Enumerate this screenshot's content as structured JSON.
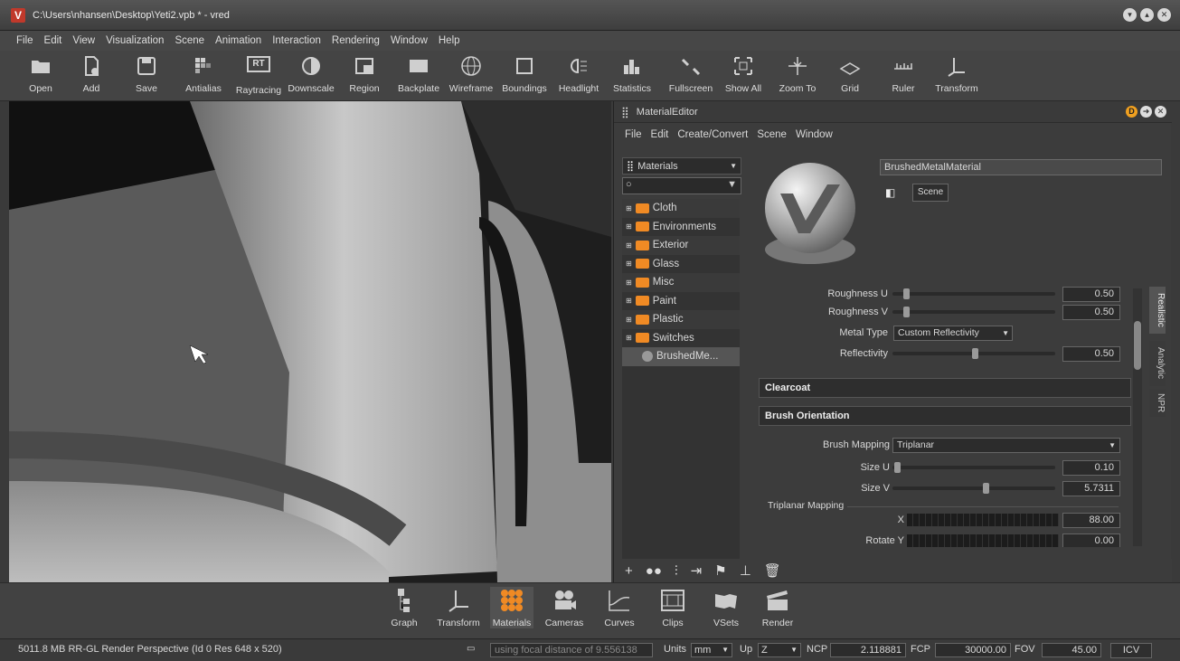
{
  "window": {
    "title": "C:\\Users\\nhansen\\Desktop\\Yeti2.vpb * - vred",
    "app_icon": "V"
  },
  "menubar": [
    "File",
    "Edit",
    "View",
    "Visualization",
    "Scene",
    "Animation",
    "Interaction",
    "Rendering",
    "Window",
    "Help"
  ],
  "toolbar": {
    "tools": [
      {
        "label": "Open",
        "icon": "folder-open-icon"
      },
      {
        "label": "Add",
        "icon": "add-file-icon"
      },
      {
        "label": "Save",
        "icon": "save-icon"
      },
      {
        "label": "Antialias",
        "icon": "antialias-icon"
      },
      {
        "label": "Raytracing",
        "icon": "raytracing-icon",
        "text": "RT"
      },
      {
        "label": "Downscale",
        "icon": "downscale-icon"
      },
      {
        "label": "Region",
        "icon": "region-icon"
      },
      {
        "label": "Backplate",
        "icon": "backplate-icon"
      },
      {
        "label": "Wireframe",
        "icon": "wireframe-icon"
      },
      {
        "label": "Boundings",
        "icon": "boundings-icon"
      },
      {
        "label": "Headlight",
        "icon": "headlight-icon"
      },
      {
        "label": "Statistics",
        "icon": "statistics-icon"
      },
      {
        "label": "Fullscreen",
        "icon": "fullscreen-icon"
      },
      {
        "label": "Show All",
        "icon": "show-all-icon"
      },
      {
        "label": "Zoom To",
        "icon": "zoom-to-icon"
      },
      {
        "label": "Grid",
        "icon": "grid-icon"
      },
      {
        "label": "Ruler",
        "icon": "ruler-icon"
      },
      {
        "label": "Transform",
        "icon": "transform-icon"
      }
    ]
  },
  "material_editor": {
    "title": "MaterialEditor",
    "menu": [
      "File",
      "Edit",
      "Create/Convert",
      "Scene",
      "Window"
    ],
    "materials_dropdown": "Materials",
    "tree": [
      "Cloth",
      "Environments",
      "Exterior",
      "Glass",
      "Misc",
      "Paint",
      "Plastic",
      "Switches",
      "BrushedMe..."
    ],
    "material_name": "BrushedMetalMaterial",
    "scene_button": "Scene",
    "props": {
      "roughness_u": {
        "label": "Roughness U",
        "value": "0.50"
      },
      "roughness_v": {
        "label": "Roughness V",
        "value": "0.50"
      },
      "metal_type": {
        "label": "Metal Type",
        "value": "Custom Reflectivity"
      },
      "reflectivity": {
        "label": "Reflectivity",
        "value": "0.50"
      },
      "clearcoat": "Clearcoat",
      "brush_orientation": "Brush Orientation",
      "brush_mapping": {
        "label": "Brush Mapping",
        "value": "Triplanar"
      },
      "size_u": {
        "label": "Size U",
        "value": "0.10"
      },
      "size_v": {
        "label": "Size V",
        "value": "5.7311"
      },
      "triplanar_mapping": "Triplanar Mapping",
      "x": {
        "label": "X",
        "value": "88.00"
      },
      "rotate_y": {
        "label": "Rotate  Y",
        "value": "0.00"
      }
    },
    "side_tabs": [
      "Realistic",
      "Analytic",
      "NPR"
    ],
    "badge": "D"
  },
  "dock": [
    {
      "label": "Graph",
      "icon": "graph-icon"
    },
    {
      "label": "Transform",
      "icon": "transform-icon"
    },
    {
      "label": "Materials",
      "icon": "materials-icon"
    },
    {
      "label": "Cameras",
      "icon": "cameras-icon"
    },
    {
      "label": "Curves",
      "icon": "curves-icon"
    },
    {
      "label": "Clips",
      "icon": "clips-icon"
    },
    {
      "label": "VSets",
      "icon": "vsets-icon"
    },
    {
      "label": "Render",
      "icon": "render-icon"
    }
  ],
  "status": {
    "info": "5011.8 MB  RR-GL  Render Perspective (Id 0 Res 648 x 520)",
    "focal_placeholder": "using focal distance of 9.556138",
    "units_label": "Units",
    "units": "mm",
    "up_label": "Up",
    "up": "Z",
    "ncp_label": "NCP",
    "ncp": "2.118881",
    "fcp_label": "FCP",
    "fcp": "30000.00",
    "fov_label": "FOV",
    "fov": "45.00",
    "icv": "ICV"
  }
}
